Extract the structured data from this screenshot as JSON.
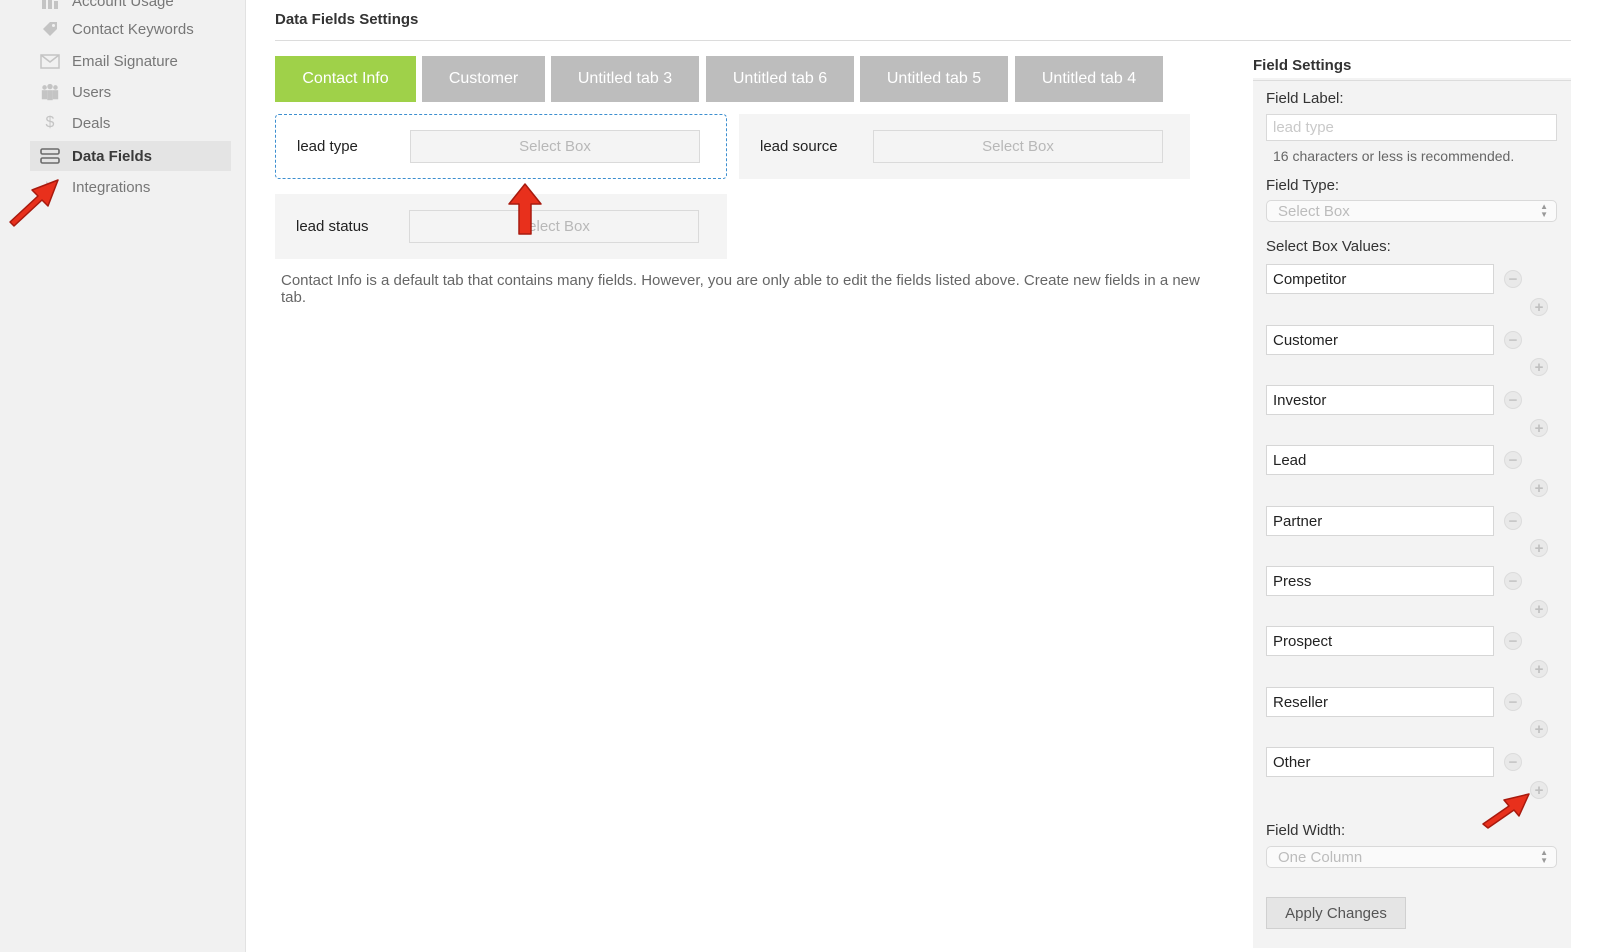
{
  "sidebar": {
    "items": [
      {
        "label": "Account Usage",
        "icon": "bar-chart-icon"
      },
      {
        "label": "Contact Keywords",
        "icon": "tag-icon"
      },
      {
        "label": "Email Signature",
        "icon": "envelope-icon"
      },
      {
        "label": "Users",
        "icon": "users-icon"
      },
      {
        "label": "Deals",
        "icon": "dollar-icon"
      },
      {
        "label": "Data Fields",
        "icon": "database-icon",
        "active": true
      },
      {
        "label": "Integrations",
        "icon": "plug-icon"
      }
    ]
  },
  "main": {
    "title": "Data Fields Settings",
    "tabs": [
      {
        "label": "Contact Info",
        "active": true
      },
      {
        "label": "Customer"
      },
      {
        "label": "Untitled tab 3"
      },
      {
        "label": "Untitled tab 6"
      },
      {
        "label": "Untitled tab 5"
      },
      {
        "label": "Untitled tab 4"
      }
    ],
    "fields": [
      {
        "label": "lead type",
        "control": "Select Box",
        "selected": true
      },
      {
        "label": "lead source",
        "control": "Select Box"
      },
      {
        "label": "lead status",
        "control": "Select Box"
      }
    ],
    "info": "Contact Info is a default tab that contains many fields. However, you are only able to edit the fields listed above. Create new fields in a new tab."
  },
  "panel": {
    "heading": "Field Settings",
    "field_label_title": "Field Label:",
    "field_label_placeholder": "lead type",
    "hint": "16 characters or less is recommended.",
    "field_type_title": "Field Type:",
    "field_type_value": "Select Box",
    "values_title": "Select Box Values:",
    "values": [
      "Competitor",
      "Customer",
      "Investor",
      "Lead",
      "Partner",
      "Press",
      "Prospect",
      "Reseller",
      "Other"
    ],
    "field_width_title": "Field Width:",
    "field_width_value": "One Column",
    "apply_label": "Apply Changes"
  },
  "colors": {
    "tab_active": "#9fd149",
    "tab_inactive": "#bdbdbd",
    "selection_border": "#3d8fd0",
    "annotation_arrow": "#e8301c"
  }
}
